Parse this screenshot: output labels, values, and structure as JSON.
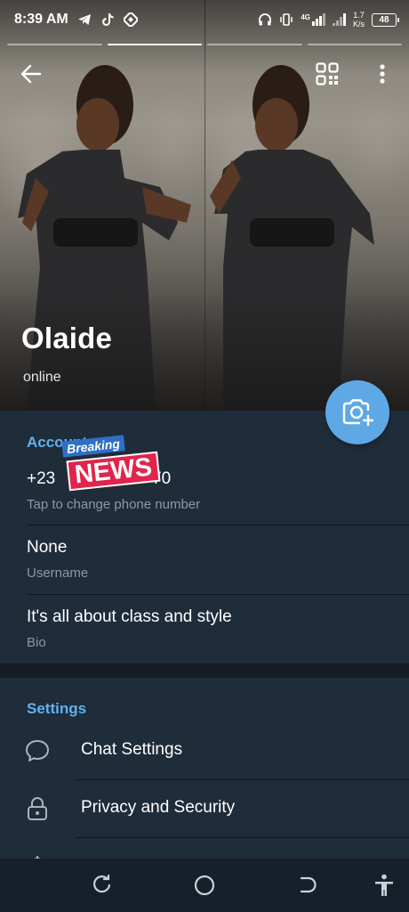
{
  "status_bar": {
    "time": "8:39 AM",
    "network_type": "4G",
    "speed_value": "1.7",
    "speed_unit": "K/s",
    "battery": "48"
  },
  "profile": {
    "name": "Olaide",
    "status": "online"
  },
  "account": {
    "section_title": "Account",
    "phone_left": "+23",
    "phone_right": "70",
    "phone_hint": "Tap to change phone number",
    "username": "None",
    "username_label": "Username",
    "bio": "It's all about class and style",
    "bio_label": "Bio"
  },
  "sticker": {
    "top": "Breaking",
    "main": "NEWS"
  },
  "settings": {
    "section_title": "Settings",
    "items": [
      {
        "label": "Chat Settings",
        "icon": "chat-bubble-icon"
      },
      {
        "label": "Privacy and Security",
        "icon": "lock-icon"
      },
      {
        "label": "",
        "icon": "notifications-icon"
      }
    ]
  },
  "story_progress": {
    "segments": 4,
    "active_index": 1
  },
  "colors": {
    "accent": "#5fb2f0",
    "fab": "#5fa8e6",
    "background": "#1f2c39",
    "sticker_red": "#e0244c",
    "sticker_blue": "#2f6fc6"
  }
}
